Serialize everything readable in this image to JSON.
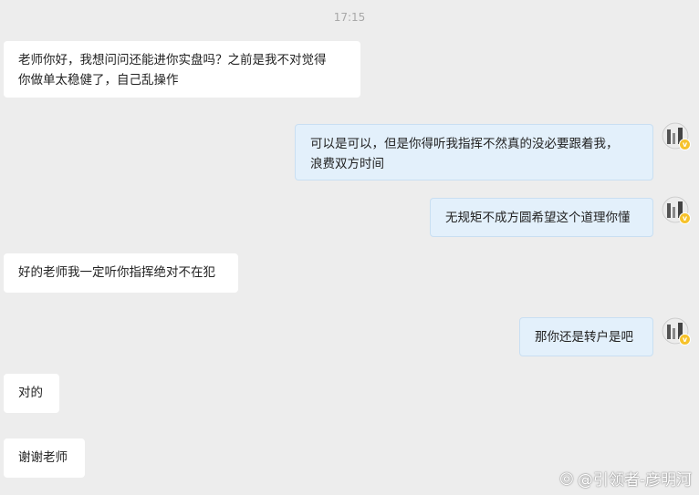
{
  "timestamp": "17:15",
  "messages": [
    {
      "side": "left",
      "lines": [
        "老师你好，我想问问还能进你实盘吗？之前是我不对觉得",
        "你做单太稳健了，自己乱操作"
      ]
    },
    {
      "side": "right",
      "lines": [
        "可以是可以，但是你得听我指挥不然真的没必要跟着我，",
        "浪费双方时间"
      ]
    },
    {
      "side": "right",
      "lines": [
        "无规矩不成方圆希望这个道理你懂"
      ]
    },
    {
      "side": "left",
      "lines": [
        "好的老师我一定听你指挥绝对不在犯"
      ]
    },
    {
      "side": "right",
      "lines": [
        "那你还是转户是吧"
      ]
    },
    {
      "side": "left",
      "lines": [
        "对的"
      ]
    },
    {
      "side": "left",
      "lines": [
        "谢谢老师"
      ]
    }
  ],
  "watermark": "@引领者-彦明河",
  "colors": {
    "background": "#ededed",
    "left_bubble": "#ffffff",
    "right_bubble": "#e3f0fb",
    "badge": "#f6c22b"
  }
}
